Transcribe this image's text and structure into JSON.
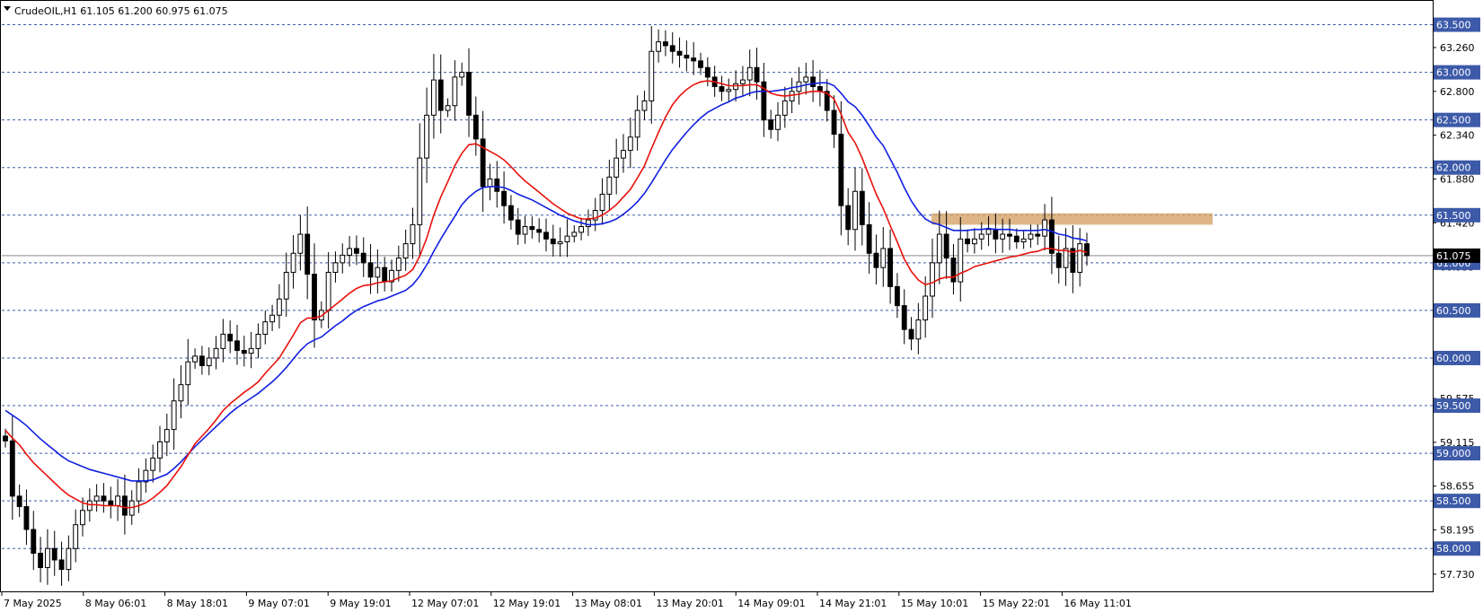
{
  "chart_data": {
    "type": "candlestick",
    "title": "CrudeOIL,H1  61.105 61.200 60.975 61.075",
    "current_price": 61.075,
    "ylim": [
      57.55,
      63.75
    ],
    "grid": "dashed horizontal at price levels",
    "level_labels": [
      "63.500",
      "63.000",
      "62.500",
      "62.000",
      "61.500",
      "61.000",
      "60.500",
      "60.000",
      "59.500",
      "59.000",
      "58.500",
      "58.000"
    ],
    "scale_labels": [
      "63.260",
      "62.800",
      "62.340",
      "61.880",
      "61.420",
      "60.955",
      "59.575",
      "59.115",
      "58.655",
      "58.195",
      "57.730"
    ],
    "x_labels": [
      "7 May 2025",
      "8 May 06:01",
      "8 May 18:01",
      "9 May 07:01",
      "9 May 19:01",
      "12 May 07:01",
      "12 May 19:01",
      "13 May 08:01",
      "13 May 20:01",
      "14 May 09:01",
      "14 May 21:01",
      "15 May 10:01",
      "15 May 22:01",
      "16 May 11:01"
    ],
    "resistance_zone": {
      "from": 61.4,
      "to": 61.52,
      "color": "#d4a368"
    },
    "colors": {
      "grid": "#3c5aa8",
      "label_bg": "#3c5aa8",
      "current_bg": "#000000",
      "ema_fast": "#e8120c",
      "ema_slow": "#1020e0",
      "bull": "#ffffff",
      "bear": "#000000"
    },
    "closes": [
      59.13,
      58.55,
      58.44,
      58.2,
      57.95,
      57.8,
      58.0,
      57.88,
      57.78,
      58.0,
      58.25,
      58.4,
      58.5,
      58.55,
      58.5,
      58.45,
      58.55,
      58.35,
      58.5,
      58.7,
      58.82,
      58.95,
      59.12,
      59.25,
      59.55,
      59.72,
      59.96,
      60.02,
      59.92,
      60.0,
      60.1,
      60.25,
      60.18,
      60.08,
      60.05,
      60.1,
      60.25,
      60.38,
      60.45,
      60.62,
      60.9,
      61.1,
      61.3,
      60.88,
      60.4,
      60.5,
      60.9,
      61.0,
      61.08,
      61.15,
      61.1,
      61.0,
      60.85,
      60.95,
      60.8,
      60.92,
      61.05,
      61.2,
      61.4,
      62.1,
      62.55,
      62.92,
      62.6,
      62.65,
      62.95,
      63.0,
      62.55,
      62.3,
      61.8,
      61.88,
      61.75,
      61.6,
      61.45,
      61.3,
      61.38,
      61.35,
      61.32,
      61.25,
      61.2,
      61.22,
      61.28,
      61.32,
      61.38,
      61.45,
      61.55,
      61.72,
      61.9,
      62.1,
      62.18,
      62.32,
      62.6,
      62.7,
      63.22,
      63.32,
      63.28,
      63.22,
      63.18,
      63.15,
      63.12,
      63.05,
      62.95,
      62.85,
      62.8,
      62.82,
      62.88,
      62.92,
      63.05,
      62.9,
      62.5,
      62.4,
      62.55,
      62.7,
      62.8,
      62.9,
      62.95,
      62.85,
      62.8,
      62.6,
      62.35,
      61.6,
      61.35,
      61.75,
      61.4,
      61.1,
      60.95,
      61.15,
      60.75,
      60.55,
      60.3,
      60.2,
      60.4,
      60.65,
      61.0,
      61.3,
      61.05,
      60.8,
      61.25,
      61.2,
      61.25,
      61.3,
      61.35,
      61.25,
      61.3,
      61.28,
      61.22,
      61.25,
      61.3,
      61.28,
      61.45,
      61.1,
      60.95,
      61.15,
      60.9,
      61.2,
      61.075
    ],
    "ema_fast": [
      59.24,
      59.16,
      59.09,
      58.99,
      58.9,
      58.83,
      58.76,
      58.69,
      58.62,
      58.56,
      58.52,
      58.48,
      58.46,
      58.46,
      58.45,
      58.45,
      58.45,
      58.43,
      58.43,
      58.45,
      58.48,
      58.53,
      58.59,
      58.66,
      58.76,
      58.86,
      58.98,
      59.1,
      59.18,
      59.26,
      59.35,
      59.45,
      59.52,
      59.58,
      59.64,
      59.69,
      59.75,
      59.84,
      59.92,
      60.0,
      60.12,
      60.24,
      60.37,
      60.42,
      60.42,
      60.44,
      60.5,
      60.56,
      60.62,
      60.68,
      60.73,
      60.76,
      60.77,
      60.79,
      60.8,
      60.81,
      60.84,
      60.87,
      60.93,
      61.07,
      61.26,
      61.5,
      61.69,
      61.85,
      62.02,
      62.15,
      62.24,
      62.25,
      62.21,
      62.17,
      62.13,
      62.08,
      62.01,
      61.93,
      61.86,
      61.8,
      61.74,
      61.68,
      61.62,
      61.57,
      61.52,
      61.49,
      61.46,
      61.46,
      61.47,
      61.5,
      61.55,
      61.61,
      61.69,
      61.77,
      61.89,
      62.02,
      62.2,
      62.37,
      62.53,
      62.66,
      62.75,
      62.82,
      62.87,
      62.9,
      62.91,
      62.9,
      62.88,
      62.86,
      62.86,
      62.86,
      62.87,
      62.87,
      62.83,
      62.78,
      62.76,
      62.75,
      62.76,
      62.77,
      62.79,
      62.8,
      62.8,
      62.78,
      62.72,
      62.56,
      62.37,
      62.26,
      62.1,
      61.91,
      61.72,
      61.57,
      61.39,
      61.22,
      61.04,
      60.91,
      60.82,
      60.77,
      60.79,
      60.83,
      60.85,
      60.85,
      60.89,
      60.92,
      60.96,
      60.98,
      61.0,
      61.02,
      61.04,
      61.06,
      61.07,
      61.09,
      61.11,
      61.12,
      61.15,
      61.15,
      61.13,
      61.13,
      61.11,
      61.13,
      61.11
    ],
    "ema_slow": [
      59.45,
      59.4,
      59.35,
      59.29,
      59.22,
      59.15,
      59.09,
      59.03,
      58.97,
      58.92,
      58.89,
      58.86,
      58.83,
      58.81,
      58.79,
      58.77,
      58.75,
      58.73,
      58.71,
      58.71,
      58.71,
      58.72,
      58.75,
      58.78,
      58.84,
      58.91,
      58.99,
      59.07,
      59.14,
      59.21,
      59.28,
      59.35,
      59.42,
      59.48,
      59.53,
      59.58,
      59.63,
      59.69,
      59.75,
      59.82,
      59.9,
      59.99,
      60.08,
      60.15,
      60.19,
      60.22,
      60.28,
      60.34,
      60.39,
      60.45,
      60.5,
      60.54,
      60.57,
      60.6,
      60.62,
      60.65,
      60.68,
      60.71,
      60.77,
      60.86,
      60.98,
      61.12,
      61.25,
      61.37,
      61.49,
      61.61,
      61.69,
      61.75,
      61.79,
      61.8,
      61.8,
      61.79,
      61.76,
      61.72,
      61.69,
      61.66,
      61.62,
      61.58,
      61.54,
      61.5,
      61.47,
      61.44,
      61.42,
      61.4,
      61.4,
      61.41,
      61.43,
      61.46,
      61.51,
      61.57,
      61.64,
      61.73,
      61.84,
      61.96,
      62.08,
      62.19,
      62.28,
      62.37,
      62.45,
      62.52,
      62.58,
      62.62,
      62.66,
      62.69,
      62.73,
      62.75,
      62.78,
      62.8,
      62.8,
      62.8,
      62.81,
      62.82,
      62.84,
      62.85,
      62.87,
      62.88,
      62.89,
      62.89,
      62.86,
      62.78,
      62.69,
      62.64,
      62.55,
      62.44,
      62.32,
      62.23,
      62.09,
      61.95,
      61.79,
      61.65,
      61.54,
      61.46,
      61.42,
      61.4,
      61.37,
      61.34,
      61.34,
      61.34,
      61.35,
      61.35,
      61.36,
      61.35,
      61.35,
      61.35,
      61.34,
      61.34,
      61.34,
      61.34,
      61.35,
      61.33,
      61.3,
      61.29,
      61.26,
      61.25,
      61.23
    ]
  }
}
